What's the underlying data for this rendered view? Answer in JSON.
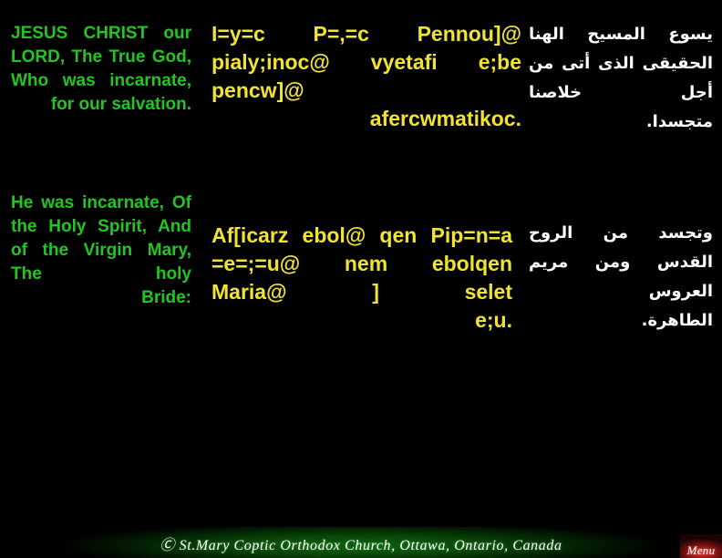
{
  "slide": {
    "background_color": "#000000",
    "english_color": "#22c522",
    "coptic_color": "#f0e332",
    "arabic_color": "#ffffff"
  },
  "blocks": [
    {
      "english": {
        "lines": [
          "JESUS CHRIST our LORD, The True God, Who was incarnate,",
          "for our salvation."
        ]
      },
      "coptic": {
        "lines": [
          "I=y=c P=,=c Pennou]@ pialy;inoc@ vyetafi e;be pencw]@",
          "afercwmatikoc."
        ]
      },
      "arabic": {
        "lines": [
          "يسوع المسيح الهنا الحقيقى الذى أتى من أجل خلاصنا",
          "متجسدا."
        ]
      }
    },
    {
      "english": {
        "lines": [
          "He was incarnate, Of the Holy Spirit, And of the Virgin Mary, The holy",
          "Bride:"
        ]
      },
      "coptic": {
        "lines": [
          "Af[icarz ebol@ qen Pip=n=a =e=;=u@ nem ebolqen Maria@ ] selet",
          "e;u."
        ]
      },
      "arabic": {
        "lines": [
          "وتجسد من الروح القدس ومن مريم العروس",
          "الطاهرة."
        ]
      }
    }
  ],
  "footer": {
    "copyright_symbol": "Ⓒ",
    "text": "St.Mary Coptic Orthodox Church, Ottawa, Ontario, Canada"
  },
  "menu_button": {
    "label": "Menu"
  }
}
